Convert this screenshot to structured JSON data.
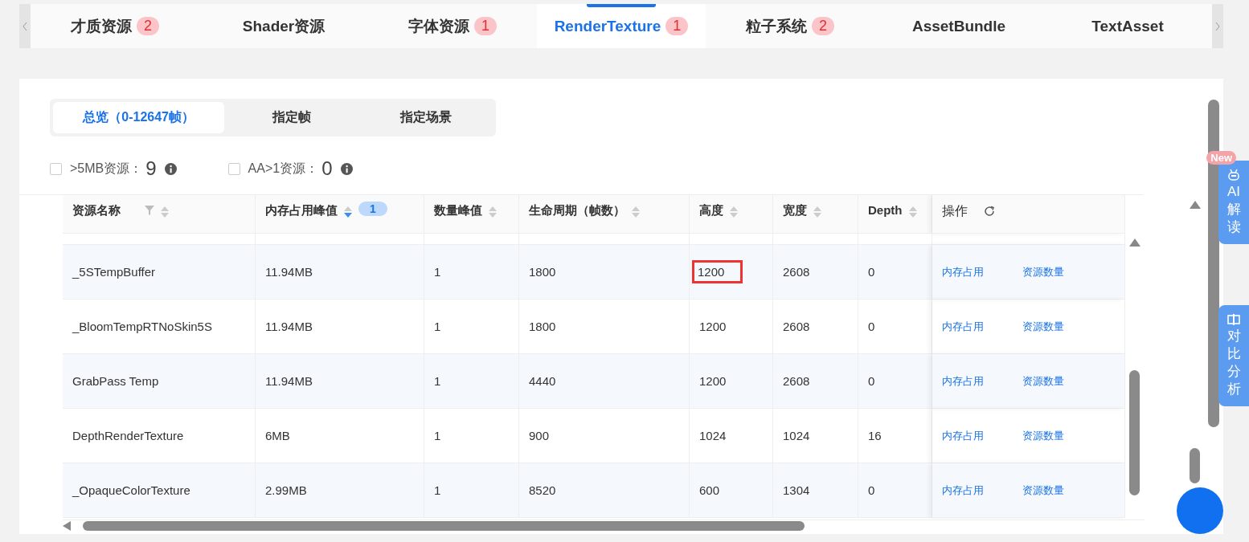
{
  "tabs": [
    {
      "label": "才质资源",
      "badge": "2",
      "selected": false
    },
    {
      "label": "Shader资源",
      "selected": false
    },
    {
      "label": "字体资源",
      "badge": "1",
      "selected": false
    },
    {
      "label": "RenderTexture",
      "badge": "1",
      "selected": true
    },
    {
      "label": "粒子系统",
      "badge": "2",
      "selected": false
    },
    {
      "label": "AssetBundle",
      "selected": false
    },
    {
      "label": "TextAsset",
      "selected": false
    }
  ],
  "segments": [
    {
      "label": "总览（0-12647帧）",
      "selected": true
    },
    {
      "label": "指定帧",
      "selected": false
    },
    {
      "label": "指定场景",
      "selected": false
    }
  ],
  "filters": [
    {
      "label": ">5MB资源：",
      "count": "9",
      "checked": false
    },
    {
      "label": "AA>1资源：",
      "count": "0",
      "checked": false
    }
  ],
  "table": {
    "columns": [
      {
        "label": "资源名称",
        "kind": "filterable",
        "sort_active": false
      },
      {
        "label": "内存占用峰值",
        "kind": "sortable",
        "sort_active": true,
        "badge": "1"
      },
      {
        "label": "数量峰值",
        "kind": "sortable",
        "sort_active": false
      },
      {
        "label": "生命周期（帧数）",
        "kind": "sortable",
        "sort_active": false
      },
      {
        "label": "高度",
        "kind": "sortable",
        "sort_active": false
      },
      {
        "label": "宽度",
        "kind": "sortable",
        "sort_active": false
      },
      {
        "label": "Depth",
        "kind": "sortable",
        "sort_active": false
      },
      {
        "label": "操作",
        "kind": "actions"
      }
    ],
    "rows": [
      {
        "cells": [
          "_5STempBuffer",
          "11.94MB",
          "1",
          "1800",
          "1200",
          "2608",
          "0"
        ],
        "actions": [
          "内存占用",
          "资源数量"
        ],
        "height_marked": true
      },
      {
        "cells": [
          "_BloomTempRTNoSkin5S",
          "11.94MB",
          "1",
          "1800",
          "1200",
          "2608",
          "0"
        ],
        "actions": [
          "内存占用",
          "资源数量"
        ],
        "height_marked": false
      },
      {
        "cells": [
          "GrabPass Temp",
          "11.94MB",
          "1",
          "4440",
          "1200",
          "2608",
          "0"
        ],
        "actions": [
          "内存占用",
          "资源数量"
        ],
        "height_marked": false
      },
      {
        "cells": [
          "DepthRenderTexture",
          "6MB",
          "1",
          "900",
          "1024",
          "1024",
          "16"
        ],
        "actions": [
          "内存占用",
          "资源数量"
        ],
        "height_marked": false
      },
      {
        "cells": [
          "_OpaqueColorTexture",
          "2.99MB",
          "1",
          "8520",
          "600",
          "1304",
          "0"
        ],
        "actions": [
          "内存占用",
          "资源数量"
        ],
        "height_marked": false
      }
    ]
  },
  "side_buttons": [
    {
      "label": "AI解读",
      "badge": "New"
    },
    {
      "label": "对比分析"
    }
  ]
}
